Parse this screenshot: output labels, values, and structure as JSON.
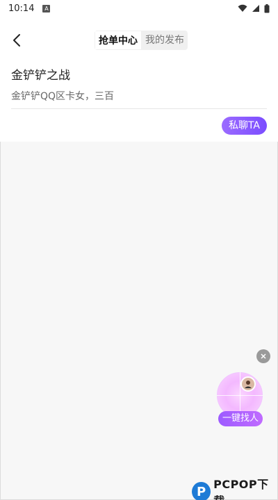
{
  "status_bar": {
    "time": "10:14",
    "notification_badge": "A",
    "icons": [
      "wifi-icon",
      "signal-icon",
      "battery-icon"
    ]
  },
  "header": {
    "back_icon": "chevron-left-icon",
    "tabs": [
      {
        "label": "抢单中心",
        "active": true
      },
      {
        "label": "我的发布",
        "active": false
      }
    ]
  },
  "post": {
    "title": "金铲铲之战",
    "description": "金铲铲QQ区卡女，三百",
    "chat_button": "私聊TA"
  },
  "floating": {
    "close_icon": "close-icon",
    "finder_label": "一键找人"
  },
  "watermark": {
    "text": "PCPOP下载"
  },
  "colors": {
    "accent": "#8a5cff",
    "background": "#f7f7f7",
    "card": "#ffffff"
  }
}
